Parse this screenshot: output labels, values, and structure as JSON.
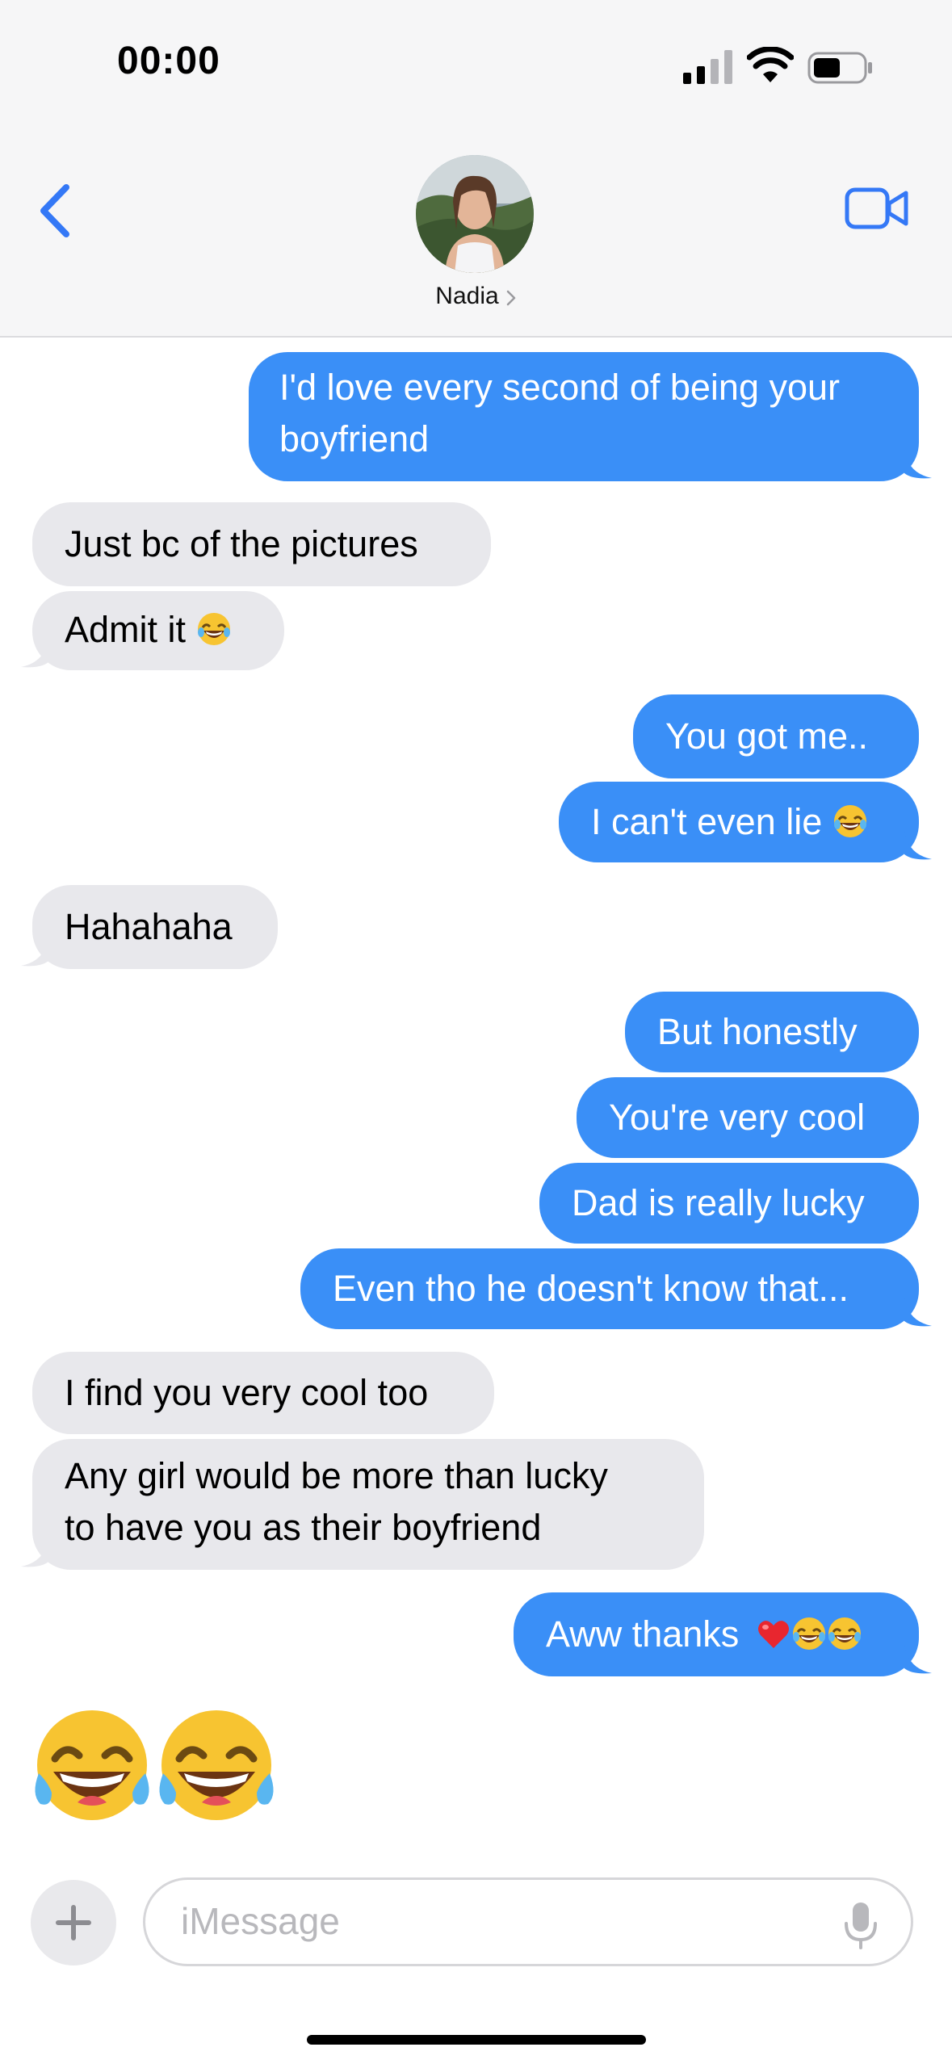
{
  "status_bar": {
    "time": "00:00",
    "battery_level": 0.55
  },
  "header": {
    "contact_name": "Nadia"
  },
  "messages": [
    {
      "side": "out",
      "lines": [
        "I'd love every second of being your",
        "boyfriend"
      ]
    },
    {
      "side": "in",
      "lines": [
        "Just bc of the pictures"
      ]
    },
    {
      "side": "in",
      "lines": [
        "Admit it"
      ],
      "emoji": "laughing-emoji"
    },
    {
      "side": "out",
      "lines": [
        "You got me.."
      ]
    },
    {
      "side": "out",
      "lines": [
        "I can't even lie"
      ],
      "emoji": "laughing-emoji"
    },
    {
      "side": "in",
      "lines": [
        "Hahahaha"
      ]
    },
    {
      "side": "out",
      "lines": [
        "But honestly"
      ]
    },
    {
      "side": "out",
      "lines": [
        "You're very cool"
      ]
    },
    {
      "side": "out",
      "lines": [
        "Dad is really lucky"
      ]
    },
    {
      "side": "out",
      "lines": [
        "Even tho he doesn't know that..."
      ]
    },
    {
      "side": "in",
      "lines": [
        "I find you very cool too"
      ]
    },
    {
      "side": "in",
      "lines": [
        "Any girl would be more than lucky",
        "to have you as their boyfriend"
      ]
    },
    {
      "side": "out",
      "lines": [
        "Aww thanks"
      ],
      "emoji": "heart-and-laughing-emojis"
    },
    {
      "side": "in",
      "big_emoji": "two-laughing-emojis"
    }
  ],
  "composer": {
    "placeholder": "iMessage"
  },
  "colors": {
    "outgoing": "#3a8ff7",
    "incoming": "#e8e8ec",
    "accent": "#3478f6"
  }
}
